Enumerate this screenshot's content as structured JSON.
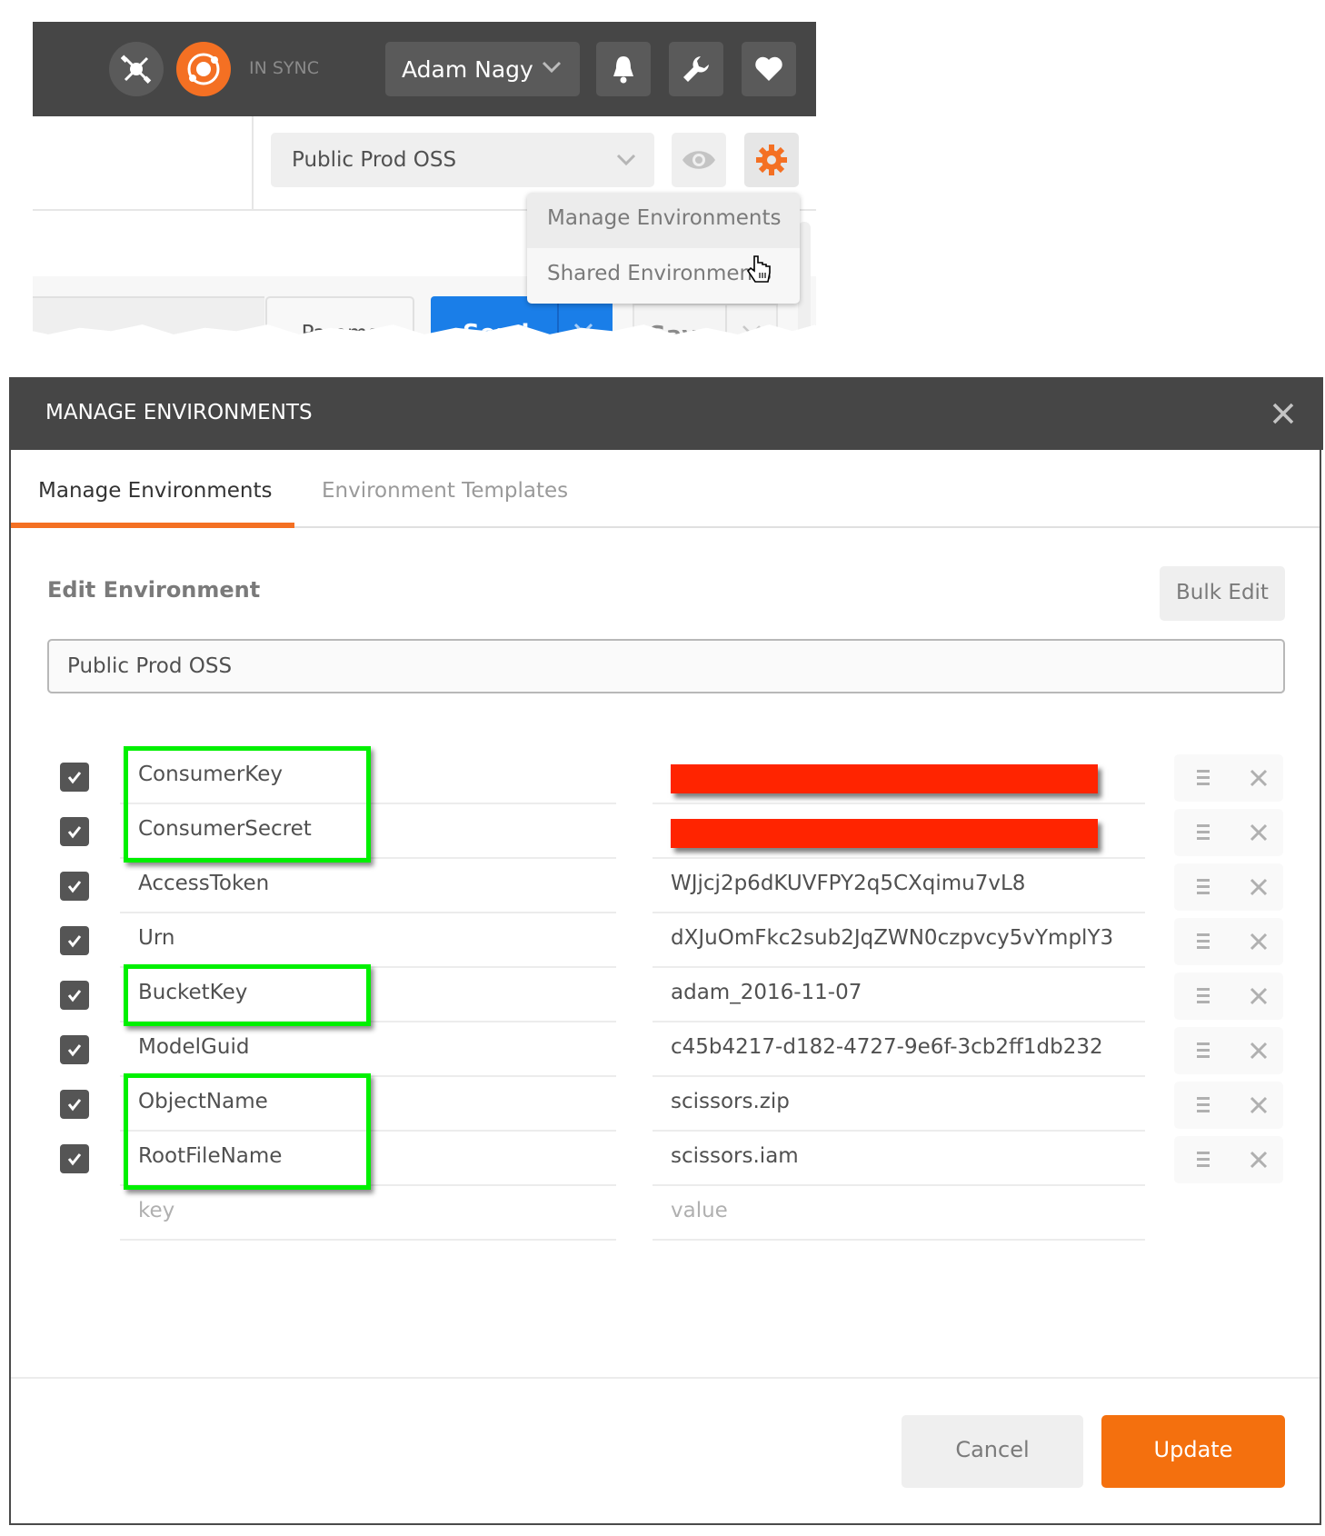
{
  "topbar": {
    "sync_status": "IN SYNC",
    "user_name": "Adam Nagy",
    "icons": [
      "satellite-icon",
      "sync-icon",
      "bell-icon",
      "wrench-icon",
      "heart-icon"
    ]
  },
  "environment_bar": {
    "selected_environment": "Public Prod OSS",
    "icons": [
      "eye-icon",
      "gear-icon"
    ]
  },
  "environment_menu": {
    "items": [
      {
        "label": "Manage Environments",
        "hovered": true
      },
      {
        "label": "Shared Environments",
        "hovered": false
      }
    ]
  },
  "request_bar": {
    "params_label": "Params",
    "send_label": "Send",
    "save_label": "Save"
  },
  "modal": {
    "title": "MANAGE ENVIRONMENTS",
    "tabs": [
      {
        "label": "Manage Environments",
        "active": true
      },
      {
        "label": "Environment Templates",
        "active": false
      }
    ],
    "heading": "Edit Environment",
    "bulk_edit_label": "Bulk Edit",
    "environment_name": "Public Prod OSS",
    "variables": [
      {
        "key": "ConsumerKey",
        "value": "",
        "redacted": true,
        "enabled": true
      },
      {
        "key": "ConsumerSecret",
        "value": "",
        "redacted": true,
        "enabled": true
      },
      {
        "key": "AccessToken",
        "value": "WJjcj2p6dKUVFPY2q5CXqimu7vL8",
        "redacted": false,
        "enabled": true
      },
      {
        "key": "Urn",
        "value": "dXJuOmFkc2sub2JqZWN0czpvcy5vYmplY3",
        "redacted": false,
        "enabled": true
      },
      {
        "key": "BucketKey",
        "value": "adam_2016-11-07",
        "redacted": false,
        "enabled": true
      },
      {
        "key": "ModelGuid",
        "value": "c45b4217-d182-4727-9e6f-3cb2ff1db232",
        "redacted": false,
        "enabled": true
      },
      {
        "key": "ObjectName",
        "value": "scissors.zip",
        "redacted": false,
        "enabled": true
      },
      {
        "key": "RootFileName",
        "value": "scissors.iam",
        "redacted": false,
        "enabled": true
      }
    ],
    "new_row": {
      "key_placeholder": "key",
      "value_placeholder": "value"
    },
    "cancel_label": "Cancel",
    "update_label": "Update"
  },
  "annotations": {
    "highlight_color": "#00f000",
    "redaction_color": "#ff2400",
    "highlighted_groups": [
      [
        "ConsumerKey",
        "ConsumerSecret"
      ],
      [
        "BucketKey"
      ],
      [
        "ObjectName",
        "RootFileName"
      ]
    ]
  },
  "colors": {
    "accent": "#f47023",
    "send_blue": "#1a7ee8",
    "header_dark": "#464646"
  }
}
